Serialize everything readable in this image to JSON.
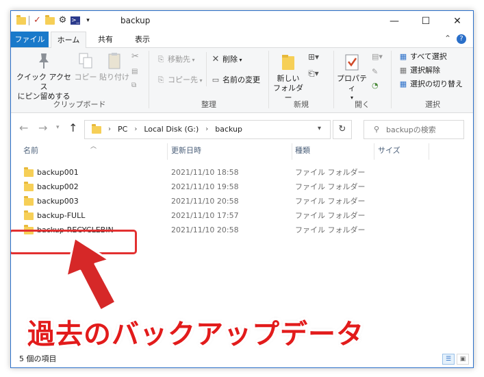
{
  "window": {
    "title": "backup",
    "minimize_glyph": "—",
    "maximize_glyph": "☐",
    "close_glyph": "✕"
  },
  "ribbon_tabs": {
    "file": "ファイル",
    "home": "ホーム",
    "share": "共有",
    "view": "表示"
  },
  "clipboard": {
    "pin": "クイック アクセス\nにピン留めする",
    "pin_line1": "クイック アクセス",
    "pin_line2": "にピン留めする",
    "copy": "コピー",
    "paste": "貼り付け",
    "group": "クリップボード"
  },
  "organize": {
    "move_to": "移動先",
    "copy_to": "コピー先",
    "delete": "削除",
    "rename": "名前の変更",
    "group": "整理"
  },
  "new": {
    "new_folder_line1": "新しい",
    "new_folder_line2": "フォルダー",
    "group": "新規"
  },
  "open": {
    "properties": "プロパティ",
    "group": "開く"
  },
  "select": {
    "select_all": "すべて選択",
    "select_none": "選択解除",
    "invert": "選択の切り替え",
    "group": "選択"
  },
  "address": {
    "crumbs": [
      "PC",
      "Local Disk (G:)",
      "backup"
    ]
  },
  "search": {
    "placeholder": "backupの検索"
  },
  "columns": {
    "name": "名前",
    "date": "更新日時",
    "type": "種類",
    "size": "サイズ"
  },
  "files": [
    {
      "name": "backup001",
      "date": "2021/11/10 18:58",
      "type": "ファイル フォルダー"
    },
    {
      "name": "backup002",
      "date": "2021/11/10 19:58",
      "type": "ファイル フォルダー"
    },
    {
      "name": "backup003",
      "date": "2021/11/10 20:58",
      "type": "ファイル フォルダー"
    },
    {
      "name": "backup-FULL",
      "date": "2021/11/10 17:57",
      "type": "ファイル フォルダー"
    },
    {
      "name": "backup-RECYCLEBIN",
      "date": "2021/11/10 20:58",
      "type": "ファイル フォルダー"
    }
  ],
  "status": {
    "count": "5 個の項目"
  },
  "annotation": {
    "caption": "過去のバックアップデータ"
  },
  "colors": {
    "accent": "#1979ca",
    "highlight": "#e23030",
    "folder": "#f6cf57"
  }
}
